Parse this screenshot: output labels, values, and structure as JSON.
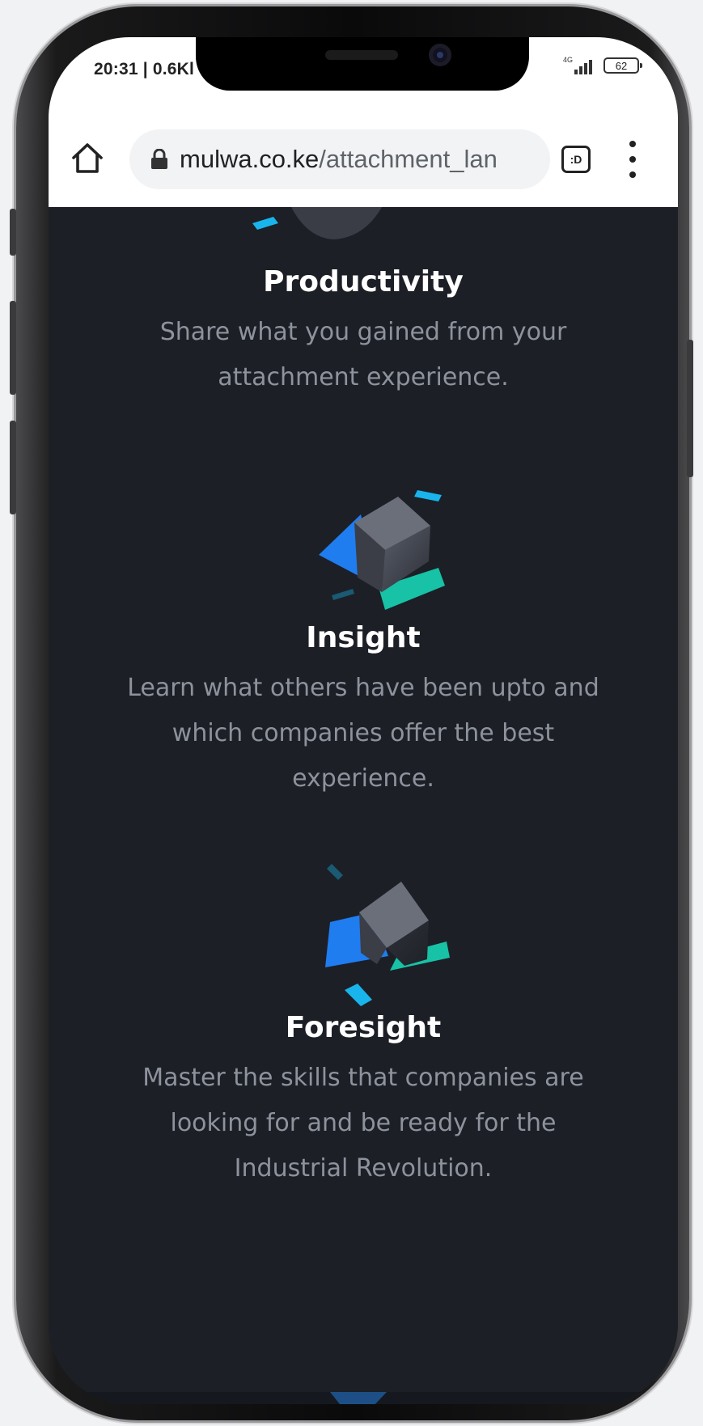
{
  "status_bar": {
    "time": "20:31 | 0.6Kl",
    "network": "4G",
    "battery": "62"
  },
  "browser": {
    "url_host": "mulwa.co.ke",
    "url_path": "/attachment_lan",
    "tabs_label": ":D"
  },
  "features": [
    {
      "title": "Productivity",
      "description_lines": [
        "Share what you gained from your",
        "attachment experience."
      ]
    },
    {
      "title": "Insight",
      "description_lines": [
        "Learn what others have been upto and",
        "which companies offer the best",
        "experience."
      ]
    },
    {
      "title": "Foresight",
      "description_lines": [
        "Master the skills that companies are",
        "looking for and be ready for the",
        "Industrial Revolution."
      ]
    }
  ],
  "colors": {
    "page_background": "#1c1f26",
    "title_text": "#ffffff",
    "body_text": "#8d929c",
    "accent_blue": "#1f7df0",
    "accent_teal": "#17c2a6",
    "accent_cyan": "#19b4ec"
  },
  "icons": {
    "home": "home-icon",
    "lock": "lock-icon",
    "menu": "more-vertical-icon"
  }
}
